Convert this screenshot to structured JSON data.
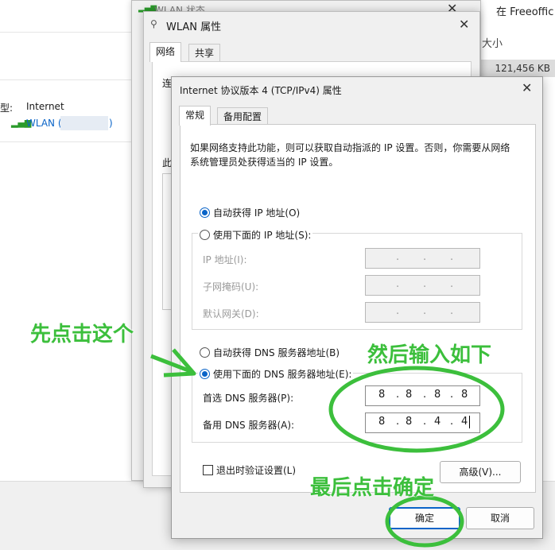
{
  "background": {
    "search_text": "在 Freeoffic",
    "col_size": "大小",
    "size_value": "121,456 KB",
    "type_label": "型:",
    "type_value": "Internet",
    "wlan_link": "WLAN (",
    "wlan_link_end": ")"
  },
  "status_window": {
    "title": "WLAN 状态"
  },
  "prop_window": {
    "title": "WLAN 属性",
    "tabs": [
      "网络",
      "共享"
    ],
    "conn_label": "连",
    "this_label": "此"
  },
  "ipv4": {
    "title": "Internet 协议版本 4 (TCP/IPv4) 属性",
    "tabs": [
      "常规",
      "备用配置"
    ],
    "description": "如果网络支持此功能，则可以获取自动指派的 IP 设置。否则，你需要从网络系统管理员处获得适当的 IP 设置。",
    "auto_ip": "自动获得 IP 地址(O)",
    "manual_ip": "使用下面的 IP 地址(S):",
    "ip_label": "IP 地址(I):",
    "subnet_label": "子网掩码(U):",
    "gateway_label": "默认网关(D):",
    "auto_dns": "自动获得 DNS 服务器地址(B)",
    "manual_dns": "使用下面的 DNS 服务器地址(E):",
    "preferred_dns_label": "首选 DNS 服务器(P):",
    "alternate_dns_label": "备用 DNS 服务器(A):",
    "preferred_dns": [
      "8",
      "8",
      "8",
      "8"
    ],
    "alternate_dns": [
      "8",
      "8",
      "4",
      "4"
    ],
    "validate_label": "退出时验证设置(L)",
    "advanced_btn": "高级(V)...",
    "ok_btn": "确定",
    "cancel_btn": "取消",
    "dot": "."
  },
  "annotations": {
    "click_this": "先点击这个",
    "enter_as_below": "然后输入如下",
    "finally_ok": "最后点击确定",
    "color": "#3cbf3c"
  }
}
